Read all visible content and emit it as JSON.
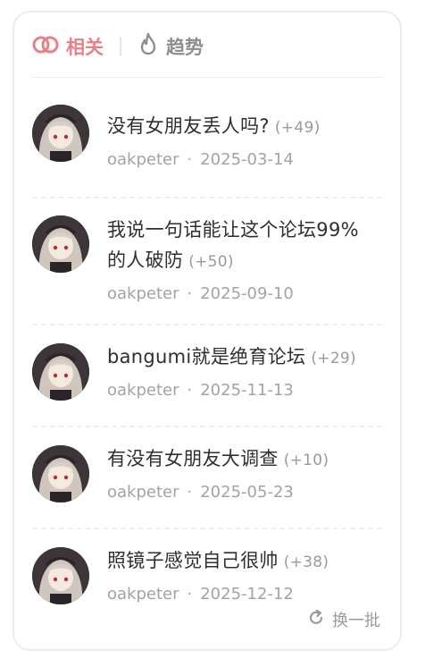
{
  "tabs": [
    {
      "label": "相关",
      "icon": "rings-icon",
      "active": true
    },
    {
      "label": "趋势",
      "icon": "flame-icon",
      "active": false
    }
  ],
  "posts": [
    {
      "title": "没有女朋友丢人吗?",
      "count": "(+49)",
      "author": "oakpeter",
      "date": "2025-03-14"
    },
    {
      "title": "我说一句话能让这个论坛99%的人破防",
      "count": "(+50)",
      "author": "oakpeter",
      "date": "2025-09-10"
    },
    {
      "title": "bangumi就是绝育论坛",
      "count": "(+29)",
      "author": "oakpeter",
      "date": "2025-11-13"
    },
    {
      "title": "有没有女朋友大调查",
      "count": "(+10)",
      "author": "oakpeter",
      "date": "2025-05-23"
    },
    {
      "title": "照镜子感觉自己很帅",
      "count": "(+38)",
      "author": "oakpeter",
      "date": "2025-12-12"
    }
  ],
  "separator": "·",
  "refresh_label": "换一批",
  "colors": {
    "accent": "#e6818a",
    "muted": "#a3a3a3",
    "text": "#2f2f2f"
  }
}
